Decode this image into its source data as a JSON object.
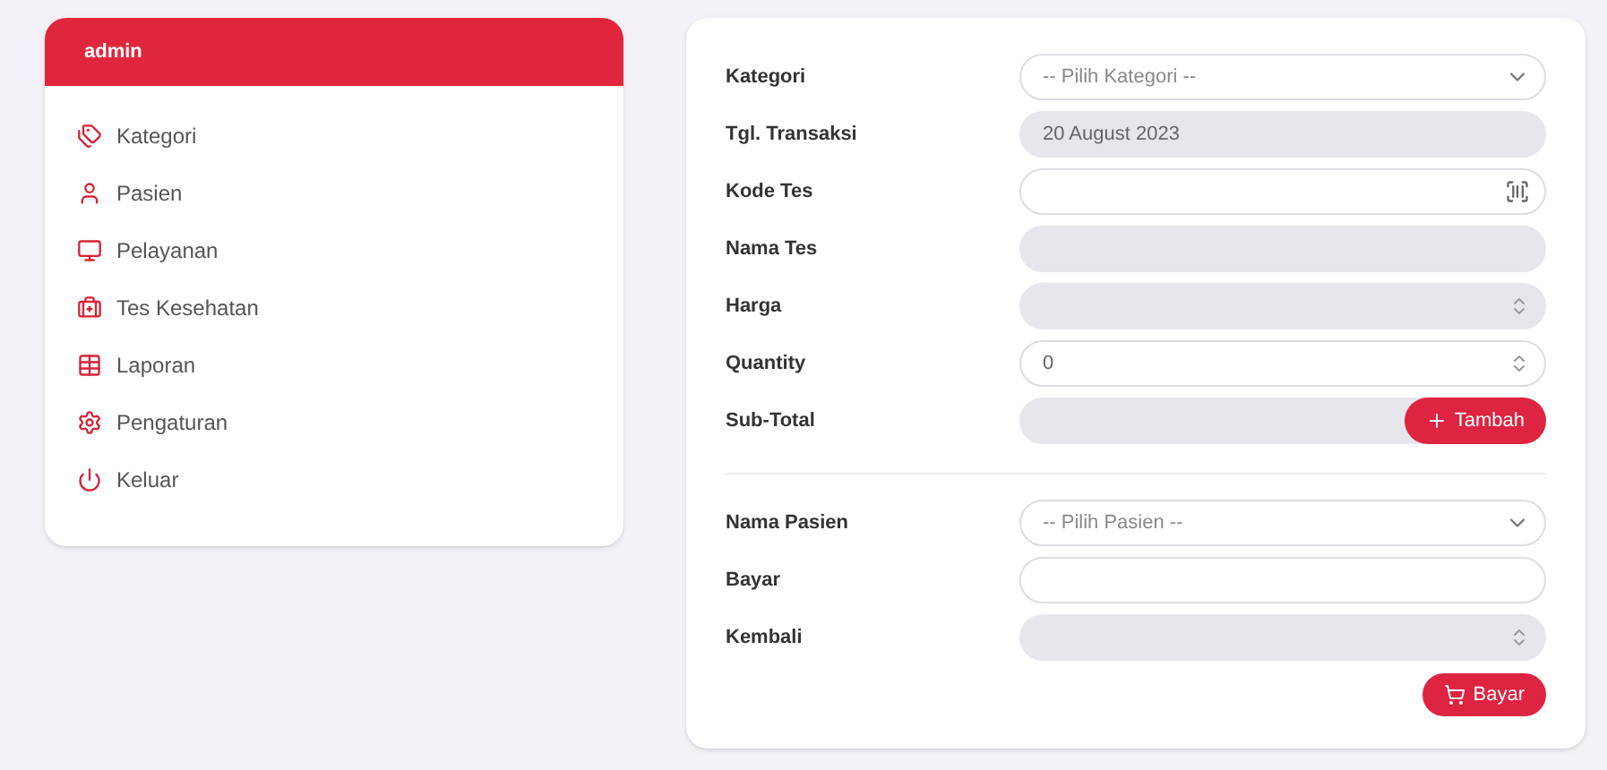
{
  "sidebar": {
    "title": "admin",
    "items": [
      {
        "label": "Kategori"
      },
      {
        "label": "Pasien"
      },
      {
        "label": "Pelayanan"
      },
      {
        "label": "Tes Kesehatan"
      },
      {
        "label": "Laporan"
      },
      {
        "label": "Pengaturan"
      },
      {
        "label": "Keluar"
      }
    ]
  },
  "form": {
    "sections": [
      {
        "fields": [
          {
            "label": "Kategori",
            "kind": "select",
            "placeholder": "-- Pilih Kategori --",
            "disabled": false
          },
          {
            "label": "Tgl. Transaksi",
            "kind": "text",
            "value": "20 August 2023",
            "disabled": true
          },
          {
            "label": "Kode Tes",
            "kind": "scan",
            "disabled": false
          },
          {
            "label": "Nama Tes",
            "kind": "text",
            "disabled": true
          },
          {
            "label": "Harga",
            "kind": "number",
            "disabled": true
          },
          {
            "label": "Quantity",
            "kind": "number",
            "value": "0",
            "disabled": false
          },
          {
            "label": "Sub-Total",
            "kind": "text",
            "disabled": true,
            "button": {
              "label": "Tambah"
            }
          }
        ]
      },
      {
        "fields": [
          {
            "label": "Nama Pasien",
            "kind": "select",
            "placeholder": "-- Pilih Pasien --",
            "disabled": false
          },
          {
            "label": "Bayar",
            "kind": "text",
            "disabled": false
          },
          {
            "label": "Kembali",
            "kind": "number",
            "disabled": true
          }
        ],
        "button": {
          "label": "Bayar"
        }
      }
    ]
  }
}
